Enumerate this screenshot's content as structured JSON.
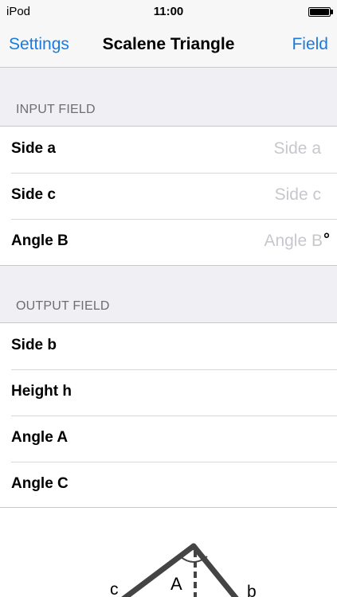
{
  "status_bar": {
    "carrier": "iPod",
    "time": "11:00",
    "battery_level": 1.0
  },
  "nav": {
    "left_button": "Settings",
    "title": "Scalene Triangle",
    "right_button": "Field"
  },
  "input_section": {
    "header": "INPUT FIELD",
    "rows": [
      {
        "label": "Side a",
        "placeholder": "Side a",
        "unit": ""
      },
      {
        "label": "Side c",
        "placeholder": "Side c",
        "unit": ""
      },
      {
        "label": "Angle B",
        "placeholder": "Angle B",
        "unit": "°"
      }
    ]
  },
  "output_section": {
    "header": "OUTPUT FIELD",
    "rows": [
      {
        "label": "Side b",
        "value": ""
      },
      {
        "label": "Height h",
        "value": ""
      },
      {
        "label": "Angle A",
        "value": ""
      },
      {
        "label": "Angle C",
        "value": ""
      }
    ]
  },
  "diagram": {
    "labels": {
      "side_c": "c",
      "angle_a": "A",
      "side_b": "b"
    },
    "stroke_color": "#444444"
  },
  "colors": {
    "accent": "#1a7bdf",
    "background": "#efeff4",
    "placeholder": "#c7c7cd",
    "section_header": "#6d6d72"
  }
}
